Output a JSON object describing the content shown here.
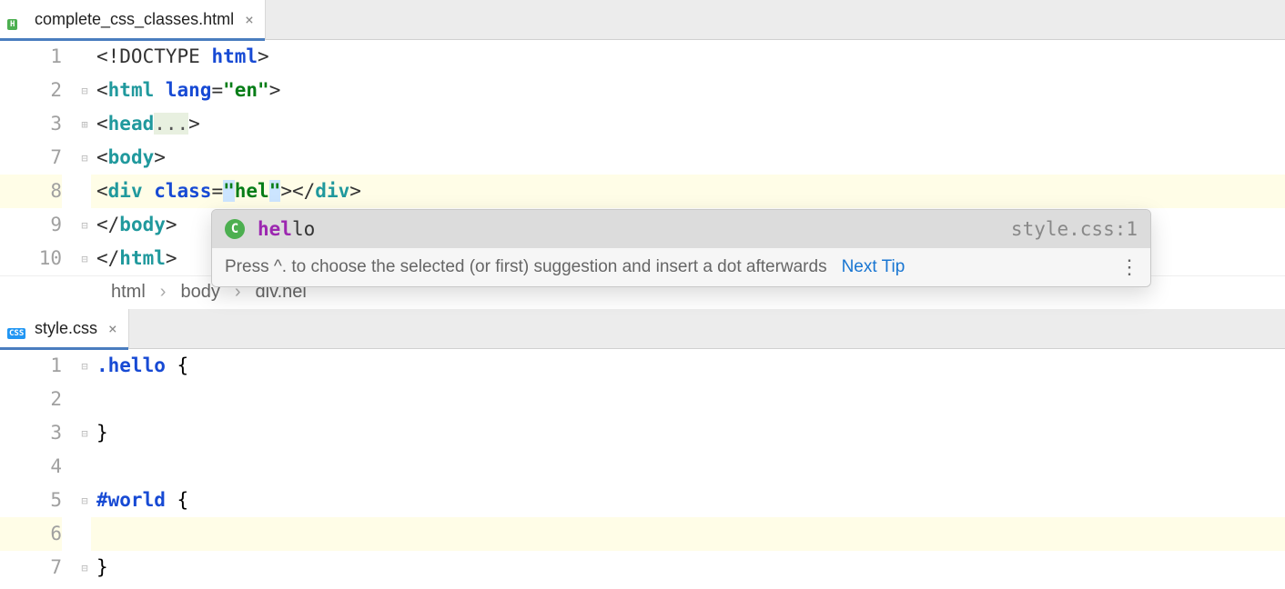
{
  "top": {
    "tab": {
      "filename": "complete_css_classes.html",
      "icon_label": "H"
    },
    "lines": [
      "1",
      "2",
      "3",
      "7",
      "8",
      "9",
      "10"
    ],
    "current_line_index": 4,
    "breadcrumb": [
      "html",
      "body",
      "div.hel"
    ],
    "code": {
      "l1": {
        "doctype": "<!DOCTYPE ",
        "html": "html",
        "close": ">"
      },
      "l2": {
        "open": "<",
        "tag": "html ",
        "attr": "lang",
        "eq": "=",
        "val": "\"en\"",
        "close": ">"
      },
      "l3": {
        "open": "<",
        "tag": "head",
        "fold": "...",
        "close": ">"
      },
      "l7": {
        "open": "<",
        "tag": "body",
        "close": ">"
      },
      "l8": {
        "open": "<",
        "tag": "div ",
        "attr": "class",
        "eq": "=",
        "q1": "\"",
        "val": "hel",
        "q2": "\"",
        "close": "></",
        "tag2": "div",
        "close2": ">"
      },
      "l9": {
        "open": "</",
        "tag": "body",
        "close": ">"
      },
      "l10": {
        "open": "</",
        "tag": "html",
        "close": ">"
      }
    }
  },
  "popup": {
    "icon": "C",
    "match": "hel",
    "rest": "lo",
    "location": "style.css:1",
    "hint": "Press ^. to choose the selected (or first) suggestion and insert a dot afterwards",
    "link": "Next Tip"
  },
  "bottom": {
    "tab": {
      "filename": "style.css",
      "icon_label": "CSS"
    },
    "lines": [
      "1",
      "2",
      "3",
      "4",
      "5",
      "6",
      "7"
    ],
    "current_line_index": 5,
    "code": {
      "l1": {
        "sel": ".hello",
        "rest": " {"
      },
      "l3": {
        "txt": "}"
      },
      "l5": {
        "sel": "#world",
        "rest": " {"
      },
      "l7": {
        "txt": "}"
      }
    }
  }
}
